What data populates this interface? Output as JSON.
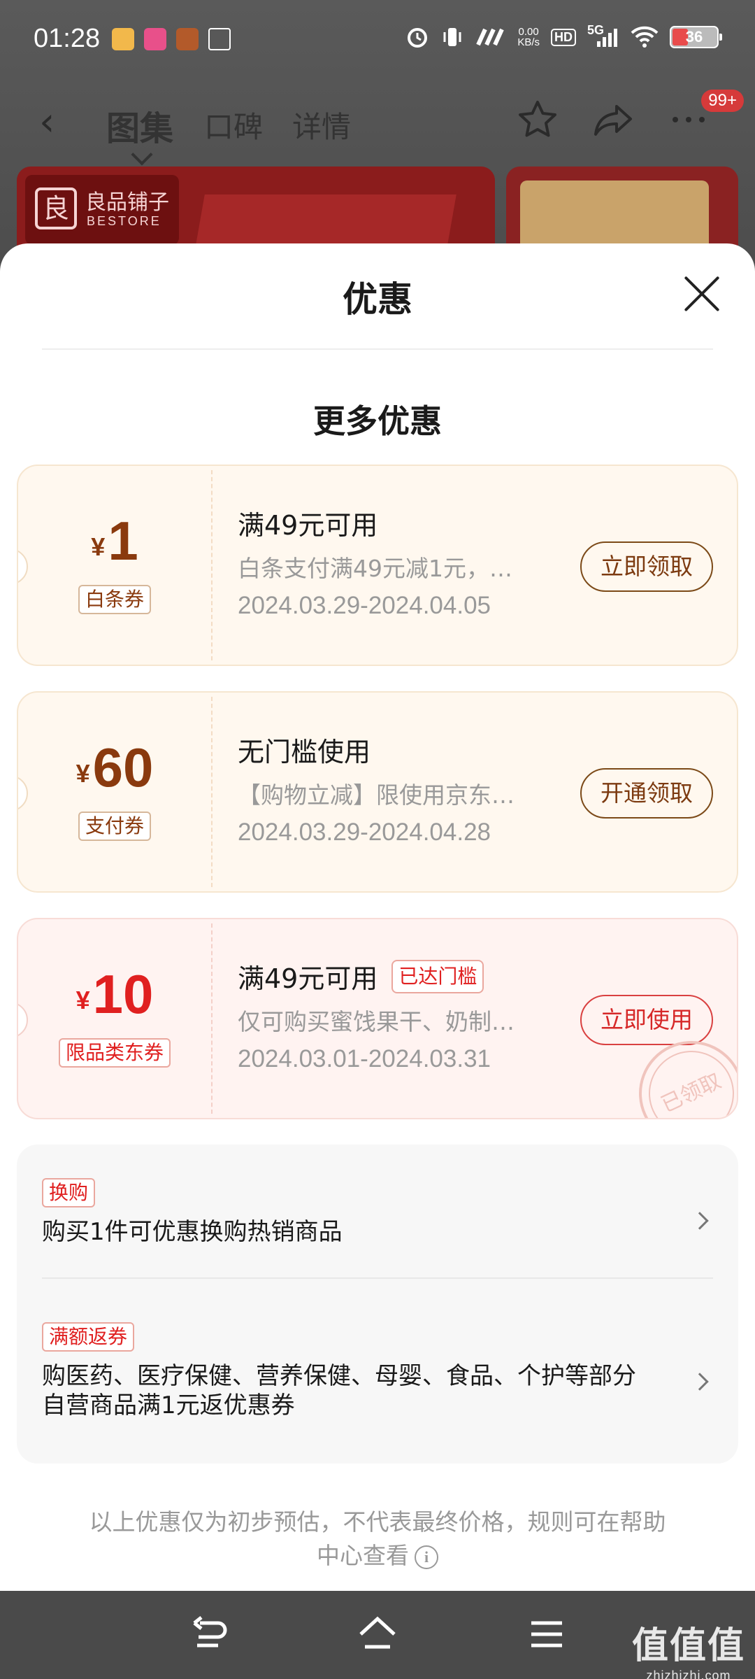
{
  "status_bar": {
    "time": "01:28",
    "net_speed_value": "0.00",
    "net_speed_unit": "KB/s",
    "hd_label": "HD",
    "signal_label": "5G",
    "battery": "36",
    "battery_level": 0.36
  },
  "nav": {
    "back_icon": "back-arrow-icon",
    "tabs": [
      "图集",
      "口碑",
      "详情"
    ],
    "active_tab": "图集",
    "badge": "99+"
  },
  "product": {
    "brand_cn": "良品铺子",
    "brand_en": "BESTORE"
  },
  "sheet": {
    "title": "优惠",
    "section_title": "更多优惠",
    "coupons": [
      {
        "currency": "¥",
        "amount": "1",
        "type": "白条券",
        "title": "满49元可用",
        "tag": "",
        "desc": "白条支付满49元减1元，…",
        "date": "2024.03.29-2024.04.05",
        "button": "立即领取",
        "style": "gold"
      },
      {
        "currency": "¥",
        "amount": "60",
        "type": "支付券",
        "title": "无门槛使用",
        "tag": "",
        "desc": "【购物立减】限使用京东…",
        "date": "2024.03.29-2024.04.28",
        "button": "开通领取",
        "style": "gold"
      },
      {
        "currency": "¥",
        "amount": "10",
        "type": "限品类东券",
        "title": "满49元可用",
        "tag": "已达门槛",
        "desc": "仅可购买蜜饯果干、奶制…",
        "date": "2024.03.01-2024.03.31",
        "button": "立即使用",
        "style": "red",
        "stamp": "已领取"
      }
    ],
    "promos": [
      {
        "tag": "换购",
        "text": "购买1件可优惠换购热销商品"
      },
      {
        "tag": "满额返券",
        "text": "购医药、医疗保健、营养保健、母婴、食品、个护等部分自营商品满1元返优惠券"
      }
    ],
    "disclaimer": "以上优惠仅为初步预估，不代表最终价格，规则可在帮助中心查看"
  },
  "watermark": {
    "main": "值值值",
    "sub": "zhizhizhi.com"
  }
}
